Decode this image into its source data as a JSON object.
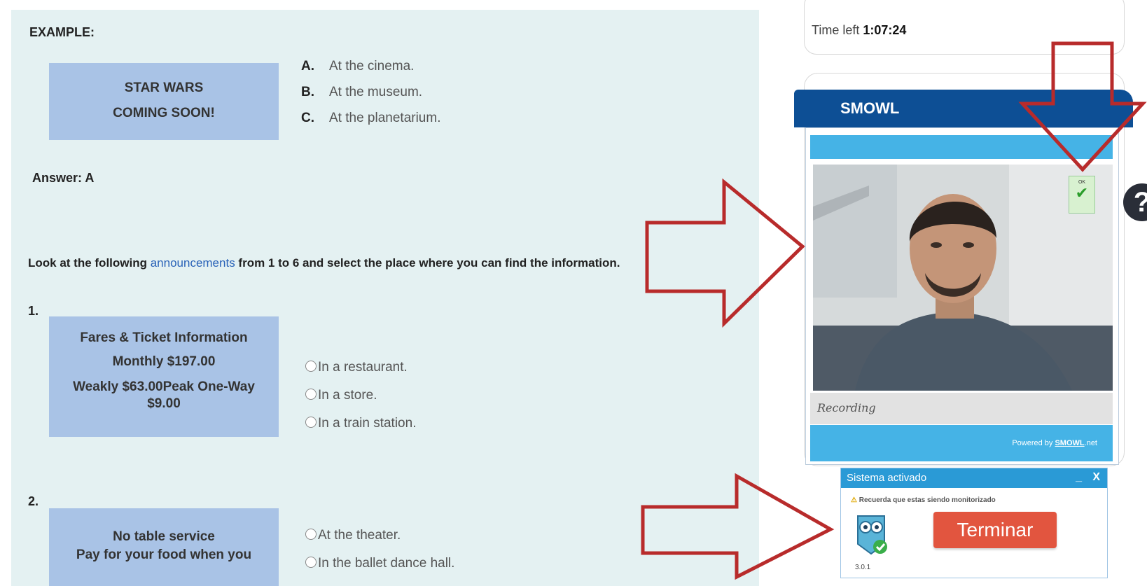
{
  "example": {
    "title": "EXAMPLE:",
    "ad_line1": "STAR WARS",
    "ad_line2": "COMING SOON!",
    "choices": [
      {
        "letter": "A.",
        "text": "At the cinema."
      },
      {
        "letter": "B.",
        "text": "At the museum."
      },
      {
        "letter": "C.",
        "text": "At the planetarium."
      }
    ],
    "answer": "Answer: A"
  },
  "instructions": {
    "before": "Look at the following ",
    "link": "announcements",
    "after": "  from 1 to 6 and select the place where you can find the information."
  },
  "questions": [
    {
      "number": "1.",
      "ad_lines": [
        "Fares & Ticket Information",
        "Monthly $197.00",
        "Weakly $63.00Peak One-Way",
        "$9.00"
      ],
      "options": [
        "In a restaurant.",
        "In a store.",
        "In a  train station."
      ]
    },
    {
      "number": "2.",
      "ad_lines": [
        "No table service",
        "Pay for your food when you"
      ],
      "options": [
        "At the theater.",
        "In the ballet dance hall."
      ]
    }
  ],
  "timer": {
    "label": "Time left ",
    "value": "1:07:24"
  },
  "smowl": {
    "title": "SMOWL",
    "badge_text": "OK",
    "status": "Recording",
    "powered_prefix": "Powered by ",
    "powered_brand": "SMOWL",
    "powered_suffix": ".net"
  },
  "help_icon": "question-circle-icon",
  "system_popup": {
    "title": "Sistema activado",
    "minimize": "_",
    "close": "X",
    "warning": "Recuerda que estas siendo monitorizado",
    "button": "Terminar",
    "version": "3.0.1"
  },
  "colors": {
    "page_bg": "#e4f1f2",
    "ad_box": "#a9c3e6",
    "smowl_header": "#0d4f95",
    "smowl_bar": "#45b3e6",
    "terminar": "#e2553f",
    "annotation_arrow": "#b82b2b"
  }
}
